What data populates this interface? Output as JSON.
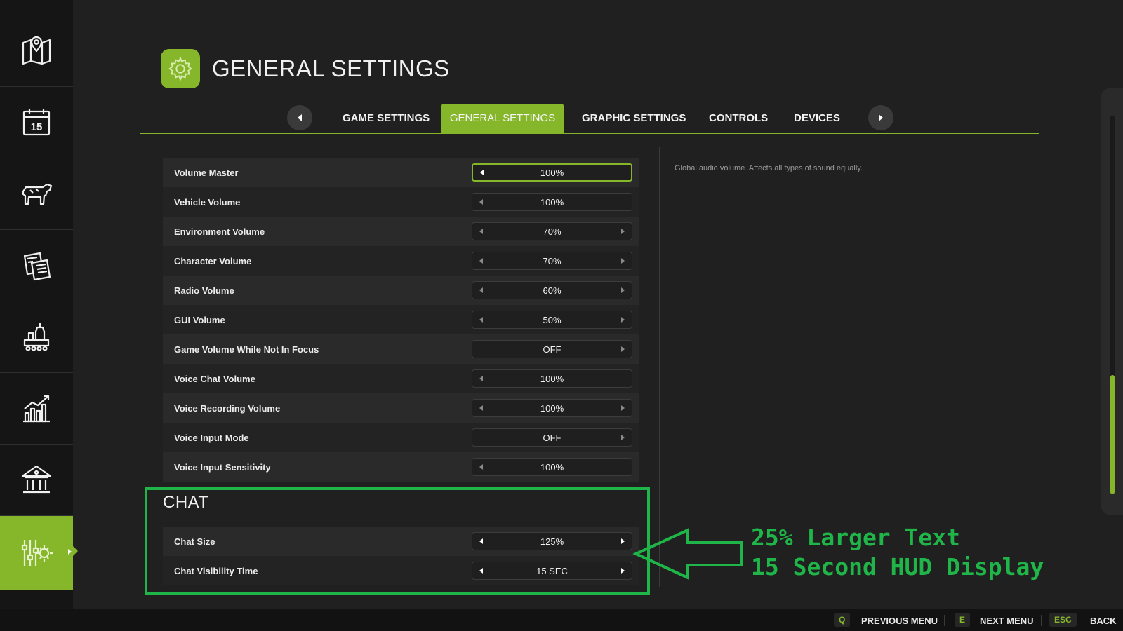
{
  "sidebar": {
    "items": [
      {
        "icon": "map-icon"
      },
      {
        "icon": "calendar-icon",
        "label": "15"
      },
      {
        "icon": "animals-icon"
      },
      {
        "icon": "contracts-icon"
      },
      {
        "icon": "production-icon"
      },
      {
        "icon": "statistics-icon"
      },
      {
        "icon": "finances-icon"
      },
      {
        "icon": "settings-icon",
        "active": true
      }
    ]
  },
  "header": {
    "title": "GENERAL SETTINGS",
    "icon": "gear-icon"
  },
  "tabs": {
    "items": [
      {
        "label": "GAME SETTINGS"
      },
      {
        "label": "GENERAL SETTINGS",
        "active": true
      },
      {
        "label": "GRAPHIC SETTINGS"
      },
      {
        "label": "CONTROLS"
      },
      {
        "label": "DEVICES"
      }
    ]
  },
  "settings": {
    "rows": [
      {
        "label": "Volume Master",
        "value": "100%"
      },
      {
        "label": "Vehicle Volume",
        "value": "100%"
      },
      {
        "label": "Environment Volume",
        "value": "70%"
      },
      {
        "label": "Character Volume",
        "value": "70%"
      },
      {
        "label": "Radio Volume",
        "value": "60%"
      },
      {
        "label": "GUI Volume",
        "value": "50%"
      },
      {
        "label": "Game Volume While Not In Focus",
        "value": "OFF"
      },
      {
        "label": "Voice Chat Volume",
        "value": "100%"
      },
      {
        "label": "Voice Recording Volume",
        "value": "100%"
      },
      {
        "label": "Voice Input Mode",
        "value": "OFF"
      },
      {
        "label": "Voice Input Sensitivity",
        "value": "100%"
      }
    ]
  },
  "description": "Global audio volume. Affects all types of sound equally.",
  "chat": {
    "title": "CHAT",
    "rows": [
      {
        "label": "Chat Size",
        "value": "125%"
      },
      {
        "label": "Chat Visibility Time",
        "value": "15 SEC"
      }
    ]
  },
  "annotation": {
    "line1": "25% Larger Text",
    "line2": "15 Second HUD Display",
    "color": "#1fb549"
  },
  "footer": {
    "items": [
      {
        "key": "Q",
        "label": "PREVIOUS MENU"
      },
      {
        "key": "E",
        "label": "NEXT MENU"
      },
      {
        "key": "ESC",
        "label": "BACK"
      }
    ]
  },
  "colors": {
    "accent": "#86b72b",
    "background": "#202020",
    "sidebar": "#151515"
  }
}
